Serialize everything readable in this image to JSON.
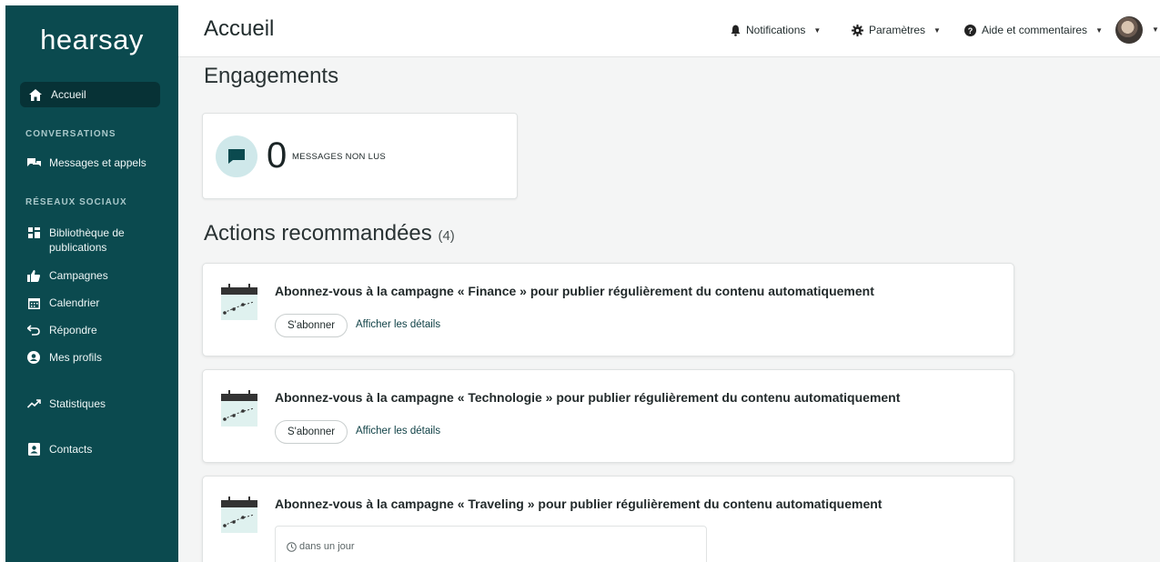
{
  "app": {
    "logo_text": "hearsay"
  },
  "sidebar": {
    "home": {
      "label": "Accueil",
      "icon": "home-icon"
    },
    "sections": {
      "conversations": "CONVERSATIONS",
      "social": "RÉSEAUX SOCIAUX"
    },
    "items": [
      {
        "label": "Messages et appels",
        "icon": "chat-bubbles-icon"
      },
      {
        "label": "Bibliothèque de publications",
        "icon": "library-icon"
      },
      {
        "label": "Campagnes",
        "icon": "thumbs-up-icon"
      },
      {
        "label": "Calendrier",
        "icon": "calendar-icon"
      },
      {
        "label": "Répondre",
        "icon": "reply-icon"
      },
      {
        "label": "Mes profils",
        "icon": "profile-icon"
      },
      {
        "label": "Statistiques",
        "icon": "trending-icon"
      },
      {
        "label": "Contacts",
        "icon": "contacts-icon"
      }
    ],
    "bg_color": "#0b4a4f"
  },
  "header": {
    "title": "Accueil",
    "notifications_label": "Notifications",
    "settings_label": "Paramètres",
    "help_label": "Aide et commentaires"
  },
  "engagements": {
    "title": "Engagements",
    "unread_count": "0",
    "unread_label": "MESSAGES NON LUS"
  },
  "actions": {
    "title": "Actions recommandées",
    "count": "(4)",
    "cards": [
      {
        "title": "Abonnez-vous à la campagne « Finance » pour publier régulièrement du contenu automatiquement",
        "subscribe_label": "S'abonner",
        "details_label": "Afficher les détails"
      },
      {
        "title": "Abonnez-vous à la campagne « Technologie » pour publier régulièrement du contenu automatiquement",
        "subscribe_label": "S'abonner",
        "details_label": "Afficher les détails"
      },
      {
        "title": "Abonnez-vous à la campagne « Traveling » pour publier régulièrement du contenu automatiquement",
        "schedule_text": "dans un jour"
      }
    ]
  }
}
